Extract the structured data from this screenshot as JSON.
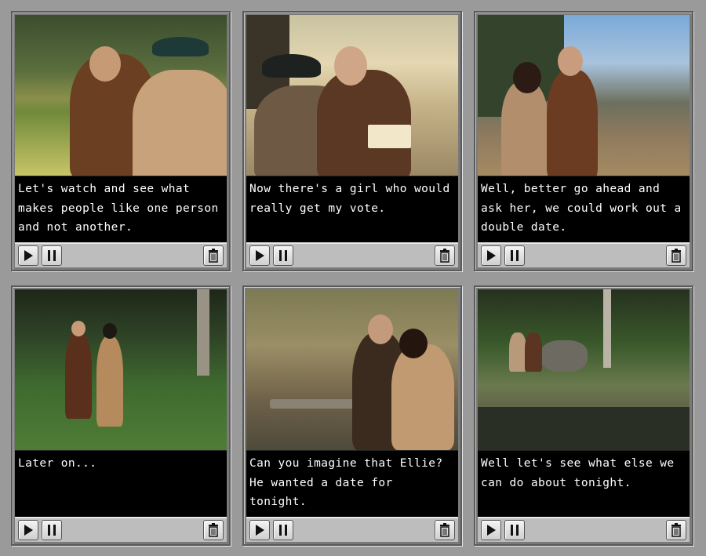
{
  "panels": [
    {
      "caption": "Let's watch and see what makes people like one person and not another."
    },
    {
      "caption": "Now there's a girl who would really get my vote."
    },
    {
      "caption": "Well, better go ahead and ask her, we could work out a double date."
    },
    {
      "caption": "Later on..."
    },
    {
      "caption": "Can you imagine that Ellie? He wanted a date for tonight."
    },
    {
      "caption": "Well let's see what else we can do about tonight."
    }
  ],
  "icons": {
    "play": "play-icon",
    "pause": "pause-icon",
    "trash": "trash-icon"
  }
}
